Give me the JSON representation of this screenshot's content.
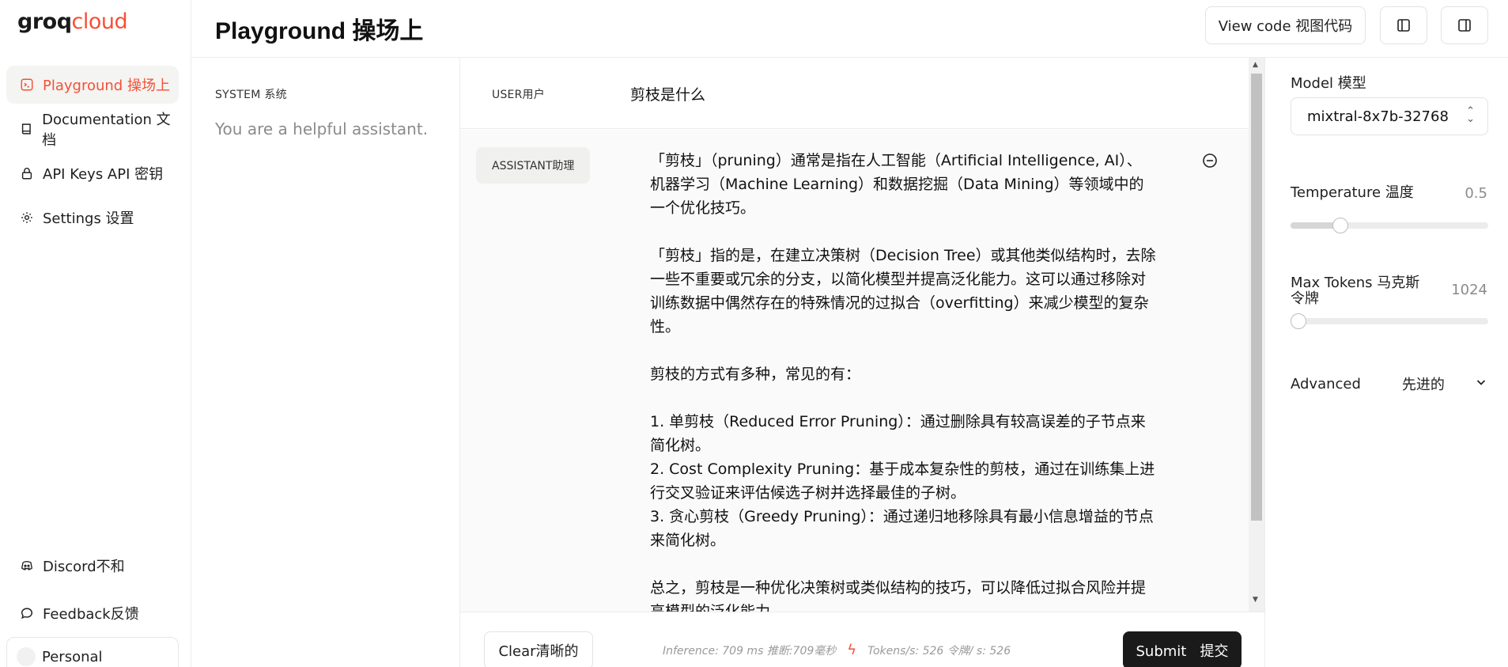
{
  "app": {
    "logo_text_1": "groq",
    "logo_text_2": "cloud",
    "accent_color": "#f55036"
  },
  "sidebar": {
    "items": [
      {
        "label": "Playground 操场上",
        "icon": "terminal-icon",
        "active": true
      },
      {
        "label": "Documentation 文档",
        "icon": "book-icon",
        "active": false
      },
      {
        "label": "API Keys API 密钥",
        "icon": "lock-icon",
        "active": false
      },
      {
        "label": "Settings 设置",
        "icon": "gear-icon",
        "active": false
      }
    ],
    "bottom": [
      {
        "label": "Discord不和",
        "icon": "discord-icon"
      },
      {
        "label": "Feedback反馈",
        "icon": "chat-bubble-icon"
      }
    ],
    "account": "Personal"
  },
  "header": {
    "title": "Playground 操场上",
    "view_code_label": "View code 视图代码"
  },
  "system": {
    "label": "SYSTEM 系统",
    "text": "You are a helpful assistant."
  },
  "chat": {
    "user_role": "USER用户",
    "user_message": "剪枝是什么",
    "assistant_role": "ASSISTANT助理",
    "assistant_paragraphs": [
      "「剪枝」（pruning）通常是指在人工智能（Artificial Intelligence, AI）、机器学习（Machine Learning）和数据挖掘（Data Mining）等领域中的一个优化技巧。",
      "「剪枝」指的是，在建立决策树（Decision Tree）或其他类似结构时，去除一些不重要或冗余的分支，以简化模型并提高泛化能力。这可以通过移除对训练数据中偶然存在的特殊情况的过拟合（overfitting）来减少模型的复杂性。",
      "剪枝的方式有多种，常见的有：",
      "1. 单剪枝（Reduced Error Pruning）：通过删除具有较高误差的子节点来简化树。\n2. Cost Complexity Pruning：基于成本复杂性的剪枝，通过在训练集上进行交叉验证来评估候选子树并选择最佳的子树。\n3. 贪心剪枝（Greedy Pruning）：通过递归地移除具有最小信息增益的节点来简化树。",
      "总之，剪枝是一种优化决策树或类似结构的技巧，可以降低过拟合风险并提高模型的泛化能力。"
    ]
  },
  "footer": {
    "clear_label": "Clear清晰的",
    "inference_text": "Inference: 709 ms 推断:709毫秒",
    "tokens_text": "Tokens/s: 526 令牌/ s: 526",
    "submit_label": "Submit   提交"
  },
  "settings": {
    "model_label": "Model 模型",
    "model_value": "mixtral-8x7b-32768",
    "temperature_label": "Temperature 温度",
    "temperature_value": "0.5",
    "temperature_fraction": 0.25,
    "max_tokens_label_1": "Max Tokens 马克斯",
    "max_tokens_label_2": "令牌",
    "max_tokens_value": "1024",
    "max_tokens_fraction": 0.03,
    "advanced_label": "Advanced",
    "advanced_label_cn": "先进的"
  }
}
